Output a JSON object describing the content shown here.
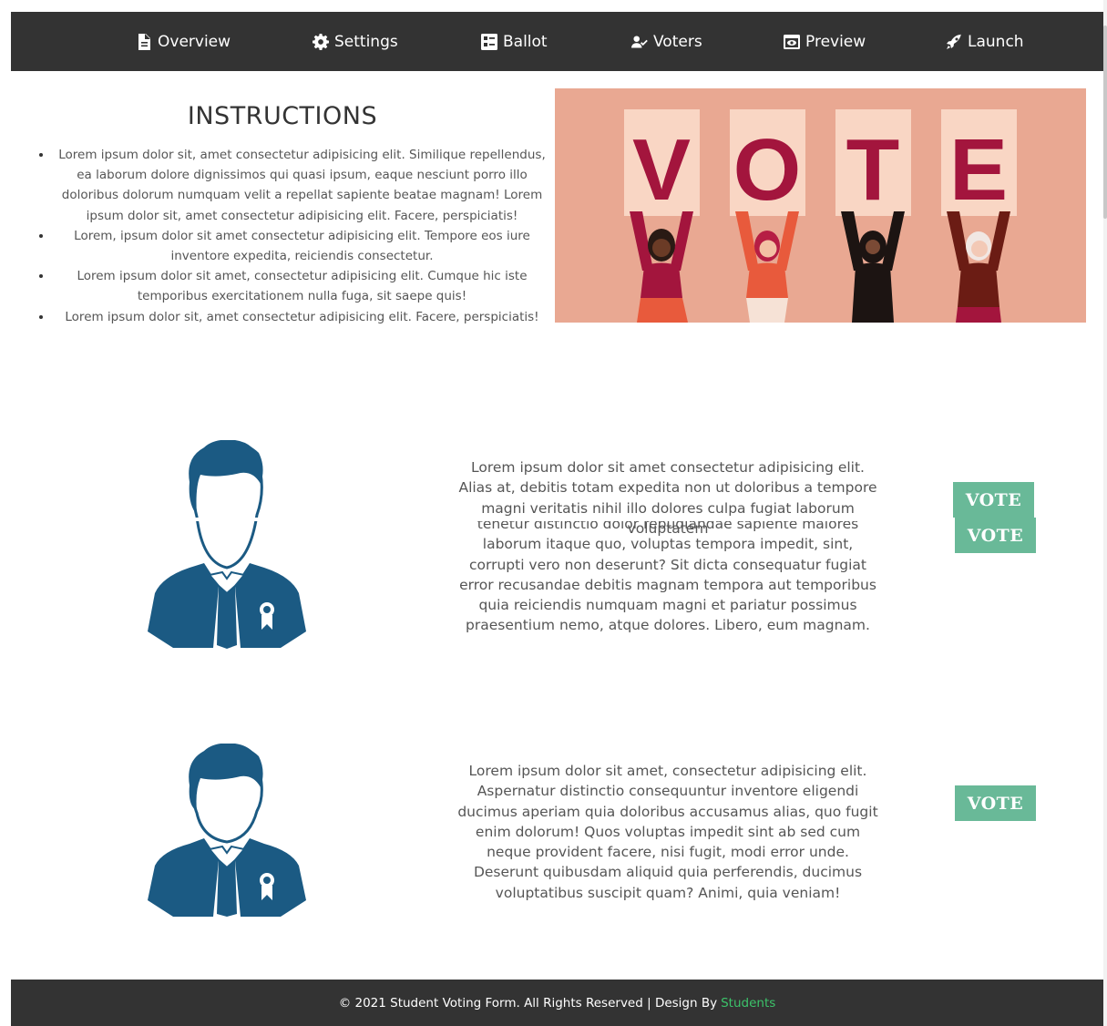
{
  "nav": {
    "items": [
      {
        "label": "Overview",
        "icon": "document-icon"
      },
      {
        "label": "Settings",
        "icon": "gear-icon"
      },
      {
        "label": "Ballot",
        "icon": "ballot-icon"
      },
      {
        "label": "Voters",
        "icon": "user-check-icon"
      },
      {
        "label": "Preview",
        "icon": "preview-icon"
      },
      {
        "label": "Launch",
        "icon": "rocket-icon"
      }
    ]
  },
  "instructions": {
    "title": "INSTRUCTIONS",
    "items": [
      "Lorem ipsum dolor sit, amet consectetur adipisicing elit. Similique repellendus, ea laborum dolore dignissimos qui quasi ipsum, eaque nesciunt porro illo doloribus dolorum numquam velit a repellat sapiente beatae magnam! Lorem ipsum dolor sit, amet consectetur adipisicing elit. Facere, perspiciatis!",
      "Lorem, ipsum dolor sit amet consectetur adipisicing elit. Tempore eos iure inventore expedita, reiciendis consectetur.",
      "Lorem ipsum dolor sit amet, consectetur adipisicing elit. Cumque hic iste temporibus exercitationem nulla fuga, sit saepe quis!",
      "Lorem ipsum dolor sit, amet consectetur adipisicing elit. Facere, perspiciatis!"
    ]
  },
  "banner": {
    "letters": [
      "V",
      "O",
      "T",
      "E"
    ],
    "colors": {
      "background": "#e9a892",
      "card": "#f9d6c4",
      "letter": "#a3153d"
    }
  },
  "candidates": [
    {
      "text_top": "Lorem ipsum dolor sit amet consectetur adipisicing elit. Alias at, debitis totam expedita non ut doloribus a tempore magni veritatis nihil illo dolores culpa fugiat laborum voluptatem",
      "text_bottom": "tenetur distinctio dolor repudiandae sapiente maiores laborum itaque quo, voluptas tempora impedit, sint, corrupti vero non deserunt? Sit dicta consequatur fugiat error recusandae debitis magnam tempora aut temporibus quia reiciendis numquam magni et pariatur possimus praesentium nemo, atque dolores. Libero, eum magnam.",
      "vote_labels": [
        "VOTE",
        "VOTE"
      ]
    },
    {
      "text": "Lorem ipsum dolor sit amet, consectetur adipisicing elit. Aspernatur distinctio consequuntur inventore eligendi ducimus aperiam quia doloribus accusamus alias, quo fugit enim dolorum! Quos voluptas impedit sint ab sed cum neque provident facere, nisi fugit, modi error unde. Deserunt quibusdam aliquid quia perferendis, ducimus voluptatibus suscipit quam? Animi, quia veniam!",
      "vote_label": "VOTE"
    }
  ],
  "footer": {
    "text": "© 2021 Student Voting Form. All Rights Reserved | Design By",
    "link": "Students"
  },
  "colors": {
    "nav_bg": "#333333",
    "vote_button": "#69b998",
    "avatar": "#1b5a83",
    "footer_link": "#3cc36a"
  }
}
